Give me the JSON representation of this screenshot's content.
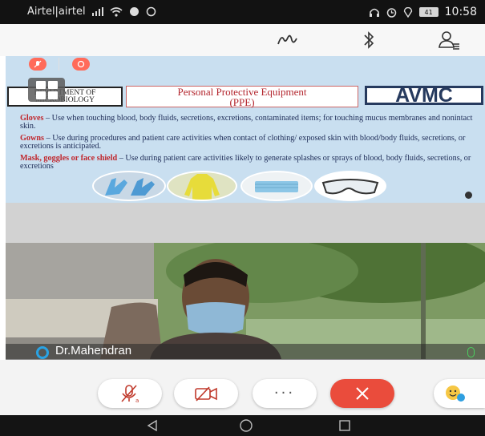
{
  "status_bar": {
    "carrier": "Airtel|airtel",
    "time": "10:58",
    "battery": "41"
  },
  "slide": {
    "department": "DEPARTMENT OF MICROBIOLOGY",
    "title_line1": "Personal Protective Equipment",
    "title_line2": "(PPE)",
    "logo": "AVMC",
    "items": [
      {
        "term": "Gloves",
        "text": " – Use when touching blood, body fluids,  secretions, excretions, contaminated items; for touching  mucus membranes and nonintact skin."
      },
      {
        "term": "Gowns",
        "text": " – Use during procedures and patient care  activities when contact of clothing/ exposed skin with  blood/body fluids, secretions, or excretions is  anticipated."
      },
      {
        "term": "Mask, goggles or face shield",
        "text": " – Use during patient care activities likely to generate splashes or sprays of  blood, body fluids, secretions, or excretions"
      }
    ],
    "images": [
      "gloves-image",
      "gown-image",
      "mask-image",
      "goggles-image"
    ]
  },
  "participant": {
    "name": "Dr.Mahendran"
  },
  "controls": {
    "more_label": "···"
  },
  "colors": {
    "end_call": "#ea4c3c",
    "slide_background": "#c9dff0",
    "accent_blue": "#29a3e4",
    "mic_green": "#4ccf60"
  }
}
